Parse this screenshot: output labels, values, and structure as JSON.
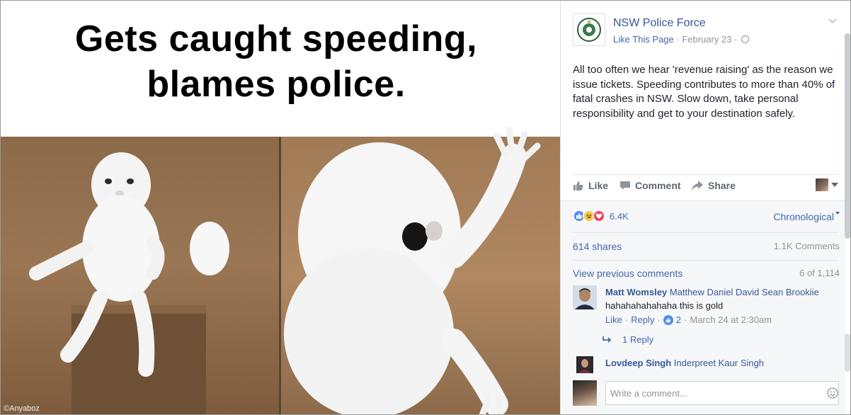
{
  "image": {
    "caption_line1": "Gets caught speeding,",
    "caption_line2": "blames police.",
    "watermark": "©Anyaboz"
  },
  "post": {
    "page_name": "NSW Police Force",
    "like_page": "Like This Page",
    "separator": " · ",
    "date": "February 23",
    "text": "All too often we hear 'revenue raising' as the reason we issue tickets. Speeding contributes to more than 40% of fatal crashes in NSW. Slow down, take personal responsibility and get to your destination safely."
  },
  "actions": {
    "like": "Like",
    "comment": "Comment",
    "share": "Share"
  },
  "stats": {
    "reactions_count": "6.4K",
    "sort_label": "Chronological",
    "shares": "614 shares",
    "comments": "1.1K Comments",
    "view_previous": "View previous comments",
    "paging": "6 of 1,114"
  },
  "comments": [
    {
      "author": "Matt Womsley",
      "tagged": "Matthew Daniel David Sean Brookiie",
      "text": "hahahahahahaha this is gold",
      "like": "Like",
      "reply": "Reply",
      "likes": "2",
      "time": "March 24 at 2:30am",
      "replies_label": "1 Reply"
    },
    {
      "author": "Lovdeep Singh",
      "tagged": "Inderpreet Kaur Singh"
    }
  ],
  "composer": {
    "placeholder": "Write a comment..."
  },
  "colors": {
    "link": "#365899",
    "accent": "#4267b2",
    "muted": "#90949c",
    "reaction_like": "#4f8df7",
    "reaction_haha": "#f7c646",
    "reaction_love": "#f33e58"
  }
}
